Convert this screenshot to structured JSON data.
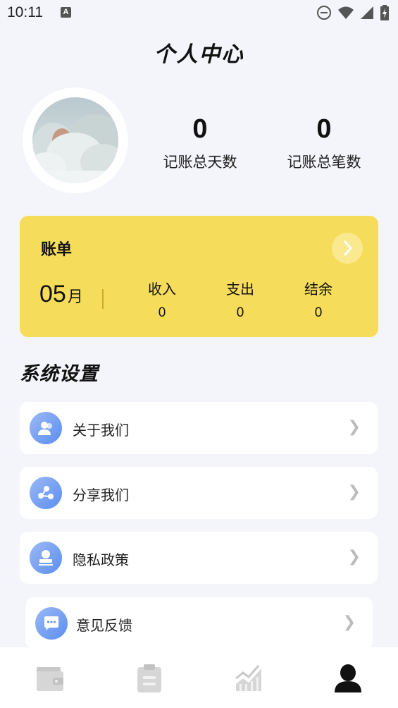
{
  "status_bar": {
    "time": "10:11",
    "notification_icon": "A"
  },
  "header": {
    "title": "个人中心"
  },
  "profile": {
    "avatar_icon": "snowy-forest-avatar",
    "stats": [
      {
        "value": "0",
        "label": "记账总天数"
      },
      {
        "value": "0",
        "label": "记账总笔数"
      }
    ]
  },
  "bill": {
    "title": "账单",
    "month_number": "05",
    "month_unit": "月",
    "columns": [
      {
        "label": "收入",
        "value": "0"
      },
      {
        "label": "支出",
        "value": "0"
      },
      {
        "label": "结余",
        "value": "0"
      }
    ],
    "card_color": "#f6dc5b"
  },
  "settings": {
    "title": "系统设置",
    "items": [
      {
        "label": "关于我们",
        "icon": "users-icon"
      },
      {
        "label": "分享我们",
        "icon": "share-icon"
      },
      {
        "label": "隐私政策",
        "icon": "stamp-icon"
      },
      {
        "label": "意见反馈",
        "icon": "chat-icon"
      }
    ]
  },
  "tab_bar": {
    "tabs": [
      {
        "icon": "wallet-icon",
        "active": false
      },
      {
        "icon": "clipboard-icon",
        "active": false
      },
      {
        "icon": "chart-icon",
        "active": false
      },
      {
        "icon": "person-icon",
        "active": true
      }
    ]
  }
}
